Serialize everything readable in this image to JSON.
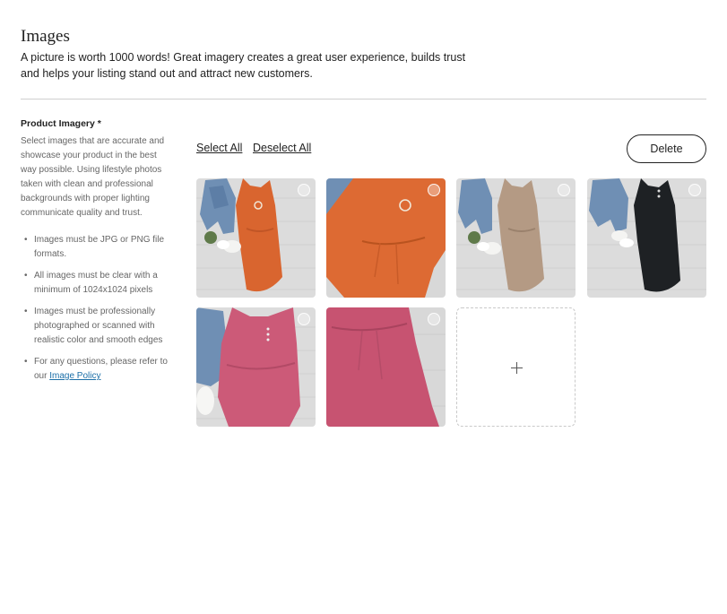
{
  "header": {
    "title": "Images",
    "intro": "A picture is worth 1000 words! Great imagery creates a great user experience, builds trust and helps your listing stand out and attract new customers."
  },
  "sidebar": {
    "heading": "Product Imagery *",
    "description": "Select images that are accurate and showcase your product in the best way possible. Using lifestyle photos taken with clean and professional backgrounds with proper lighting communicate quality and trust.",
    "bullets": [
      "Images must be JPG or PNG file formats.",
      "All images must be clear with a minimum of 1024x1024 pixels",
      "Images must be professionally photographed or scanned with realistic color and smooth edges"
    ],
    "policy_prefix": "For any questions, please refer to our",
    "policy_link": "Image Policy"
  },
  "toolbar": {
    "select_all": "Select All",
    "deselect_all": "Deselect All",
    "delete": "Delete"
  },
  "gallery": {
    "images": [
      {
        "name": "orange dress flat lay with denim jacket",
        "dress_color": "#d9652f",
        "selected": false
      },
      {
        "name": "orange dress close-up",
        "dress_color": "#dd6a33",
        "selected": false
      },
      {
        "name": "taupe dress flat lay with denim jacket",
        "dress_color": "#b49a84",
        "selected": false
      },
      {
        "name": "black dress flat lay with denim jacket",
        "dress_color": "#1e2124",
        "selected": false
      },
      {
        "name": "pink dress flat lay with denim jacket",
        "dress_color": "#cc5a78",
        "selected": false
      },
      {
        "name": "pink dress close-up",
        "dress_color": "#c75371",
        "selected": false
      }
    ],
    "add_icon": "plus-icon"
  }
}
